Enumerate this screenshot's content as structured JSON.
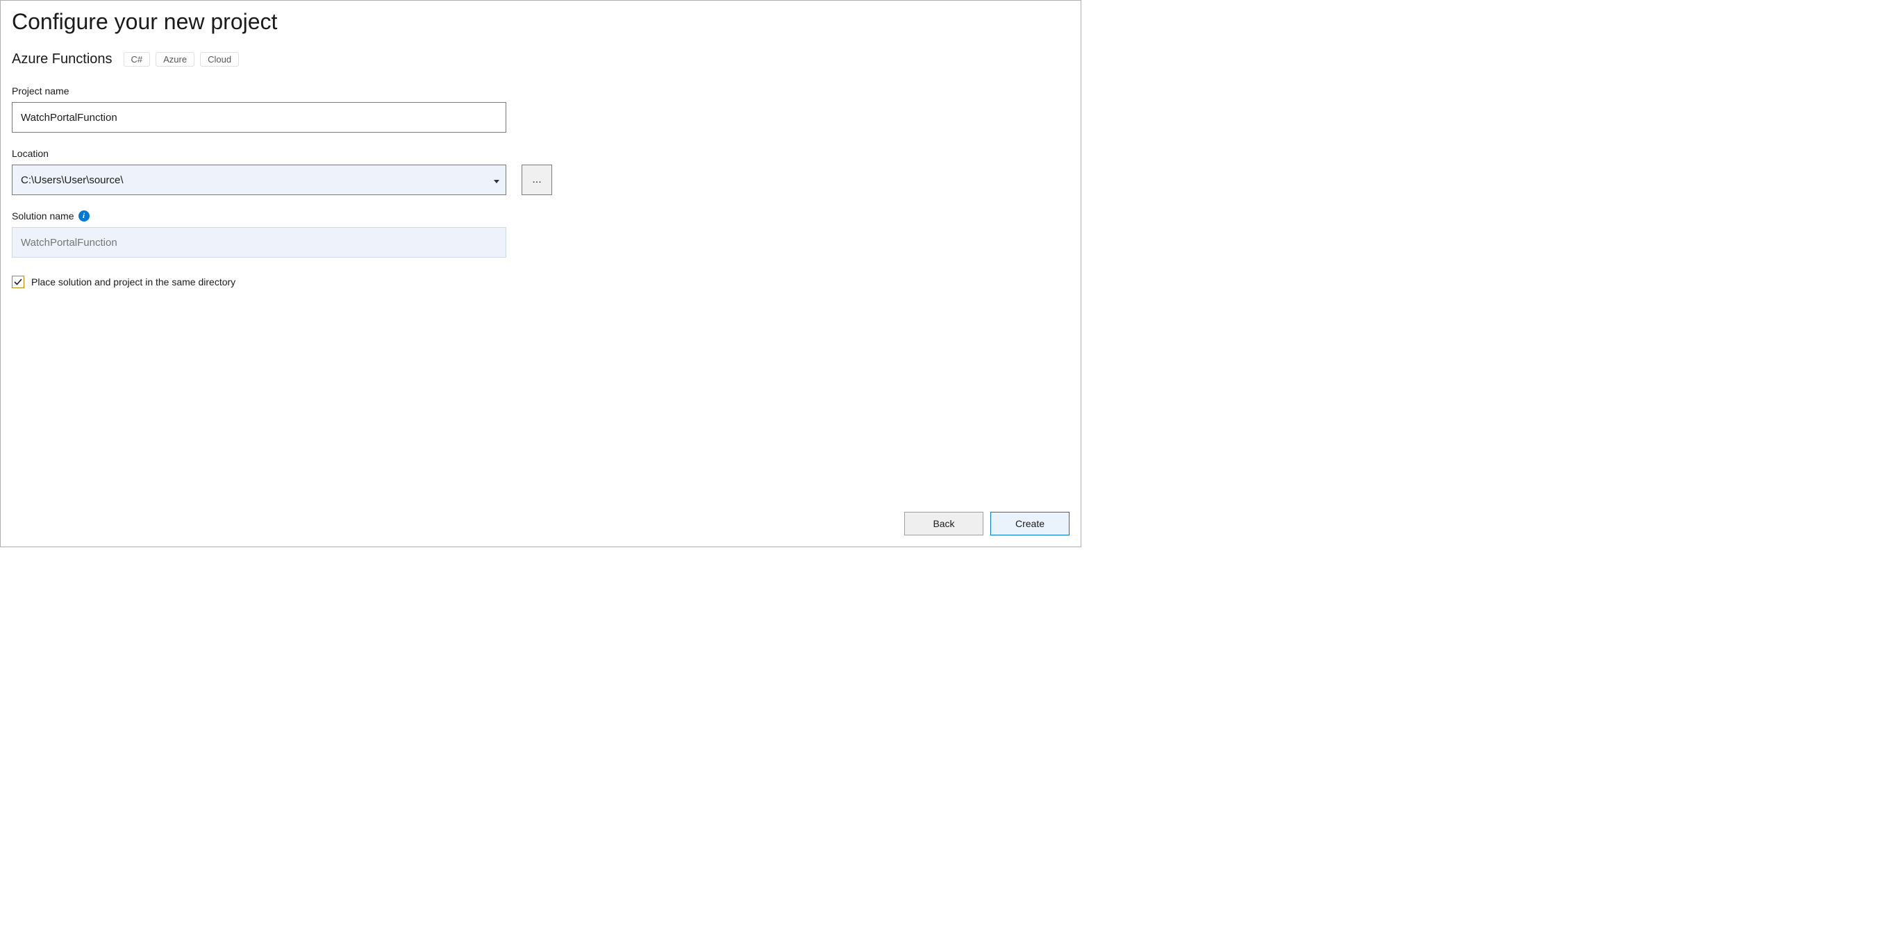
{
  "header": {
    "title": "Configure your new project",
    "template": "Azure Functions",
    "tags": [
      "C#",
      "Azure",
      "Cloud"
    ]
  },
  "fields": {
    "projectName": {
      "label": "Project name",
      "value": "WatchPortalFunction"
    },
    "location": {
      "label": "Location",
      "value": "C:\\Users\\User\\source\\",
      "browseLabel": "..."
    },
    "solutionName": {
      "label": "Solution name",
      "placeholder": "WatchPortalFunction"
    },
    "sameDirectory": {
      "label": "Place solution and project in the same directory",
      "checked": true
    }
  },
  "footer": {
    "back": "Back",
    "create": "Create"
  }
}
